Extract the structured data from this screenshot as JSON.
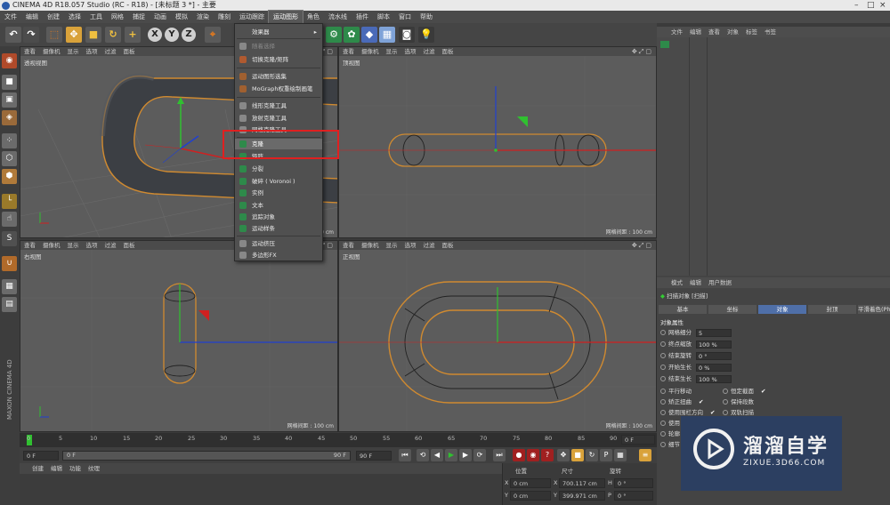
{
  "title_bar": {
    "title": "CINEMA 4D R18.057 Studio (RC - R18) - [未标题 3 *] - 主要"
  },
  "menu": [
    "文件",
    "编辑",
    "创建",
    "选择",
    "工具",
    "网格",
    "捕捉",
    "动画",
    "模拟",
    "渲染",
    "雕刻",
    "运动跟踪",
    "运动图形",
    "角色",
    "流水线",
    "插件",
    "脚本",
    "窗口",
    "帮助"
  ],
  "active_menu": "运动图形",
  "toolbar": {
    "axes": [
      "X",
      "Y",
      "Z"
    ]
  },
  "viewports": {
    "header_items": [
      "查看",
      "摄像机",
      "显示",
      "选项",
      "过滤",
      "面板"
    ],
    "perspective": {
      "name": "透视视图",
      "grid": "网格间距 : 1000 cm"
    },
    "top": {
      "name": "顶视图",
      "grid": "网格间距 : 100 cm"
    },
    "right": {
      "name": "右视图",
      "grid": "网格间距 : 100 cm"
    },
    "front": {
      "name": "正视图",
      "grid": "网格间距 : 100 cm"
    }
  },
  "dropdown": {
    "items": [
      {
        "label": "效果器",
        "dim": false,
        "hl": false
      },
      {
        "label": "随着选择",
        "dim": true,
        "hl": false
      },
      {
        "label": "切换克隆/矩阵",
        "dim": false,
        "hl": false
      },
      {
        "label": "运动图形选集",
        "dim": false,
        "hl": false
      },
      {
        "label": "MoGraph权重绘制画笔",
        "dim": false,
        "hl": false
      },
      {
        "label": "线形克隆工具",
        "dim": false,
        "hl": false
      },
      {
        "label": "放射克隆工具",
        "dim": false,
        "hl": false
      },
      {
        "label": "网格克隆工具",
        "dim": false,
        "hl": false
      },
      {
        "label": "克隆",
        "dim": false,
        "hl": true
      },
      {
        "label": "矩阵",
        "dim": false,
        "hl": false
      },
      {
        "label": "分裂",
        "dim": false,
        "hl": false
      },
      {
        "label": "破碎 ( Voronoi )",
        "dim": false,
        "hl": false
      },
      {
        "label": "实例",
        "dim": false,
        "hl": false
      },
      {
        "label": "文本",
        "dim": false,
        "hl": false
      },
      {
        "label": "追踪对象",
        "dim": false,
        "hl": false
      },
      {
        "label": "运动样条",
        "dim": false,
        "hl": false
      },
      {
        "label": "运动挤压",
        "dim": false,
        "hl": false
      },
      {
        "label": "多边形FX",
        "dim": false,
        "hl": false
      }
    ]
  },
  "object_manager": {
    "menu": [
      "文件",
      "编辑",
      "查看",
      "对象",
      "标签",
      "书签"
    ]
  },
  "attributes": {
    "menu": [
      "模式",
      "编辑",
      "用户数据"
    ],
    "object_label": "扫描对象 [扫描]",
    "tabs": [
      "基本",
      "坐标",
      "对象",
      "封顶",
      "平滑着色(Pho"
    ],
    "active_tab": "对象",
    "section": "对象属性",
    "props": [
      {
        "label": "网格细分",
        "value": "5"
      },
      {
        "label": "终点缩放",
        "value": "100 %"
      },
      {
        "label": "结束旋转",
        "value": "0 °"
      },
      {
        "label": "开始生长",
        "value": "0 %"
      },
      {
        "label": "结束生长",
        "value": "100 %"
      }
    ],
    "checks": [
      {
        "left": "平行移动",
        "right": "恒定截面"
      },
      {
        "left": "矫正扭曲",
        "right": "保持段数"
      },
      {
        "left": "使用围栏方向",
        "right": "双轨扫描"
      },
      {
        "left": "使用",
        "right": ""
      },
      {
        "left": "轮廓",
        "right": ""
      },
      {
        "left": "细节",
        "right": ""
      }
    ]
  },
  "timeline": {
    "ticks": [
      "0",
      "5",
      "10",
      "15",
      "20",
      "25",
      "30",
      "35",
      "40",
      "45",
      "50",
      "55",
      "60",
      "65",
      "70",
      "75",
      "80",
      "85",
      "90"
    ],
    "end_field": "0 F"
  },
  "transport": {
    "start": "0 F",
    "current": "0 F",
    "end_inner": "90 F",
    "end": "90 F"
  },
  "material_bar": {
    "menu": [
      "创建",
      "编辑",
      "功能",
      "纹理"
    ]
  },
  "coordinates": {
    "headers": [
      "位置",
      "尺寸",
      "旋转"
    ],
    "rows": [
      {
        "axis": "X",
        "pos": "0 cm",
        "size": "700.117 cm",
        "rot_axis": "H",
        "rot": "0 °"
      },
      {
        "axis": "Y",
        "pos": "0 cm",
        "size": "399.971 cm",
        "rot_axis": "P",
        "rot": "0 °"
      }
    ]
  },
  "sidebar_vertical": "MAXON CINEMA 4D",
  "watermark": {
    "title": "溜溜自学",
    "url": "ZIXUE.3D66.COM"
  },
  "colors": {
    "accent": "#e0a030",
    "highlight_box": "#e02020",
    "selected_tab": "#4f6fa8"
  }
}
